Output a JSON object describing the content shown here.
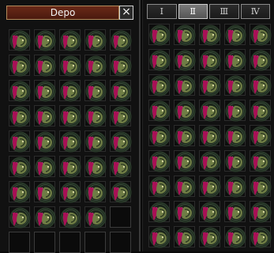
{
  "depo": {
    "title": "Depo",
    "close_label": "×",
    "columns": 5,
    "slots": [
      "item",
      "item",
      "item",
      "item",
      "item",
      "item",
      "item",
      "item",
      "item",
      "item",
      "item",
      "item",
      "item",
      "item",
      "item",
      "item",
      "item",
      "item",
      "item",
      "item",
      "item",
      "item",
      "item",
      "item",
      "item",
      "item",
      "item",
      "item",
      "item",
      "item",
      "item",
      "item",
      "item",
      "item",
      "item",
      "item",
      "item",
      "item",
      "item",
      "empty",
      "empty",
      "empty",
      "empty",
      "empty",
      "empty"
    ]
  },
  "inventory": {
    "tabs": [
      {
        "label": "Ⅰ",
        "active": false
      },
      {
        "label": "Ⅱ",
        "active": true
      },
      {
        "label": "Ⅲ",
        "active": false
      },
      {
        "label": "Ⅳ",
        "active": false
      }
    ],
    "columns": 5,
    "rows": 9
  },
  "icon": "armor-with-magenta-cape-icon",
  "colors": {
    "cape": "#b0105a",
    "armor": "#6f7d45",
    "ring": "#2a3a2a"
  }
}
